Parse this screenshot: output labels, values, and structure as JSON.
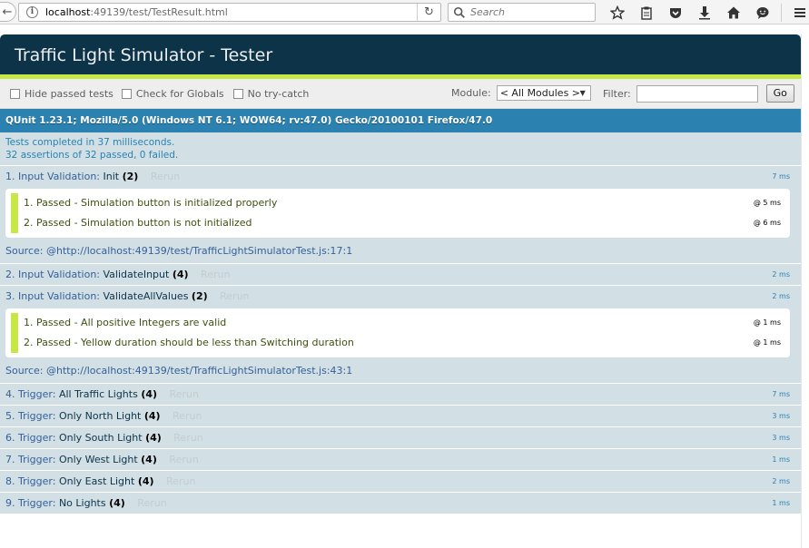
{
  "browser": {
    "back_glyph": "←",
    "info_glyph": "i",
    "url_host": "localhost",
    "url_path": ":49139/test/TestResult.html",
    "reload_glyph": "↻",
    "search_placeholder": "Search"
  },
  "qunit": {
    "title": "Traffic Light Simulator - Tester",
    "toolbar": {
      "hide_passed": "Hide passed tests",
      "check_globals": "Check for Globals",
      "no_try_catch": "No try-catch",
      "module_label": "Module:",
      "module_value": "< All Modules >",
      "filter_label": "Filter:",
      "go_label": "Go"
    },
    "user_agent": "QUnit 1.23.1; Mozilla/5.0 (Windows NT 6.1; WOW64; rv:47.0) Gecko/20100101 Firefox/47.0",
    "result_line1": "Tests completed in 37 milliseconds.",
    "result_line2": "32 assertions of 32 passed, 0 failed.",
    "tests": [
      {
        "num": "1.",
        "module": "Input Validation:",
        "name": "Init",
        "counts": "(2)",
        "rerun": "Rerun",
        "runtime": "7 ms",
        "assertions": [
          {
            "text": "1. Passed - Simulation button is initialized properly",
            "runtime": "@ 5 ms"
          },
          {
            "text": "2. Passed - Simulation button is not initialized",
            "runtime": "@ 6 ms"
          }
        ],
        "source_label": "Source:",
        "source": "@http://localhost:49139/test/TrafficLightSimulatorTest.js:17:1"
      },
      {
        "num": "2.",
        "module": "Input Validation:",
        "name": "ValidateInput",
        "counts": "(4)",
        "rerun": "Rerun",
        "runtime": "2 ms"
      },
      {
        "num": "3.",
        "module": "Input Validation:",
        "name": "ValidateAllValues",
        "counts": "(2)",
        "rerun": "Rerun",
        "runtime": "2 ms",
        "assertions": [
          {
            "text": "1. Passed - All positive Integers are valid",
            "runtime": "@ 1 ms"
          },
          {
            "text": "2. Passed - Yellow duration should be less than Switching duration",
            "runtime": "@ 1 ms"
          }
        ],
        "source_label": "Source:",
        "source": "@http://localhost:49139/test/TrafficLightSimulatorTest.js:43:1"
      },
      {
        "num": "4.",
        "module": "Trigger:",
        "name": "All Traffic Lights",
        "counts": "(4)",
        "rerun": "Rerun",
        "runtime": "7 ms"
      },
      {
        "num": "5.",
        "module": "Trigger:",
        "name": "Only North Light",
        "counts": "(4)",
        "rerun": "Rerun",
        "runtime": "3 ms"
      },
      {
        "num": "6.",
        "module": "Trigger:",
        "name": "Only South Light",
        "counts": "(4)",
        "rerun": "Rerun",
        "runtime": "3 ms"
      },
      {
        "num": "7.",
        "module": "Trigger:",
        "name": "Only West Light",
        "counts": "(4)",
        "rerun": "Rerun",
        "runtime": "1 ms"
      },
      {
        "num": "8.",
        "module": "Trigger:",
        "name": "Only East Light",
        "counts": "(4)",
        "rerun": "Rerun",
        "runtime": "2 ms"
      },
      {
        "num": "9.",
        "module": "Trigger:",
        "name": "No Lights",
        "counts": "(4)",
        "rerun": "Rerun",
        "runtime": "1 ms"
      }
    ]
  },
  "colors": {
    "header_bg": "#0d3349",
    "banner_pass": "#c6e746",
    "useragent_bg": "#2b81af",
    "test_bg": "#d2e0e6"
  }
}
